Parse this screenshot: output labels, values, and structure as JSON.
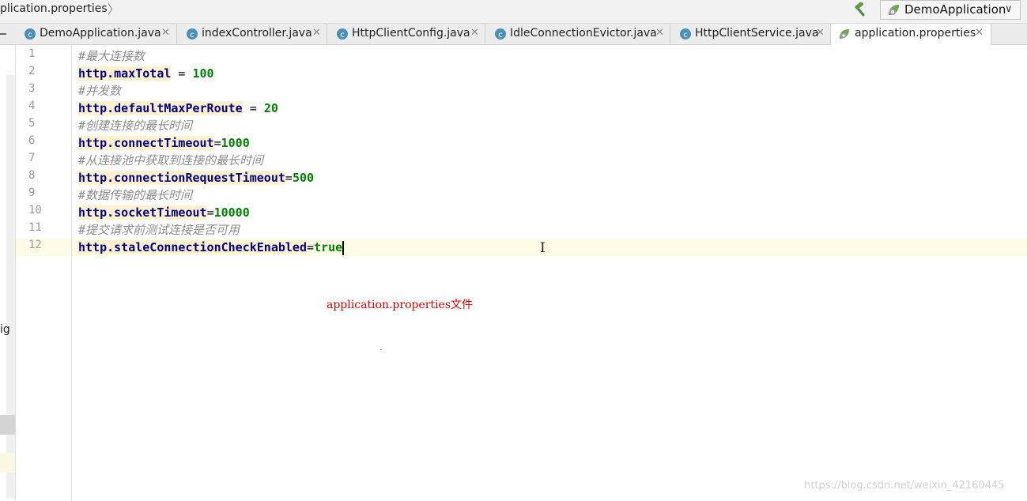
{
  "breadcrumb": {
    "file": "plication.properties"
  },
  "run_config": {
    "label": "DemoApplication"
  },
  "tabs": [
    {
      "label": "DemoApplication.java",
      "icon": "class-c-icon"
    },
    {
      "label": "indexController.java",
      "icon": "class-c-icon"
    },
    {
      "label": "HttpClientConfig.java",
      "icon": "class-c-icon"
    },
    {
      "label": "IdleConnectionEvictor.java",
      "icon": "class-c-icon"
    },
    {
      "label": "HttpClientService.java",
      "icon": "class-c-icon"
    },
    {
      "label": "application.properties",
      "icon": "spring-leaf-icon",
      "active": true
    }
  ],
  "left_panel": {
    "fragment": "ig"
  },
  "editor": {
    "lines": [
      {
        "n": "1",
        "comment": "#最大连接数"
      },
      {
        "n": "2",
        "key": "http.maxTotal",
        "sep": " = ",
        "value": "100"
      },
      {
        "n": "3",
        "comment": "#并发数"
      },
      {
        "n": "4",
        "key": "http.defaultMaxPerRoute",
        "sep": " = ",
        "value": "20"
      },
      {
        "n": "5",
        "comment": "#创建连接的最长时间"
      },
      {
        "n": "6",
        "key": "http.connectTimeout",
        "sep": "=",
        "value": "1000"
      },
      {
        "n": "7",
        "comment": "#从连接池中获取到连接的最长时间"
      },
      {
        "n": "8",
        "key": "http.connectionRequestTimeout",
        "sep": "=",
        "value": "500"
      },
      {
        "n": "9",
        "comment": "#数据传输的最长时间"
      },
      {
        "n": "10",
        "key": "http.socketTimeout",
        "sep": "=",
        "value": "10000"
      },
      {
        "n": "11",
        "comment": "#提交请求前测试连接是否可用"
      },
      {
        "n": "12",
        "key": "http.staleConnectionCheckEnabled",
        "sep": "=",
        "value": "true"
      }
    ],
    "current_line": "12"
  },
  "annotation": "application.properties文件",
  "watermark": "https://blog.csdn.net/weixin_42160445",
  "colors": {
    "comment": "#8c8c8c",
    "key": "#000080",
    "value": "#008000",
    "annotation": "#d40000",
    "current_line": "#fefbe6"
  }
}
